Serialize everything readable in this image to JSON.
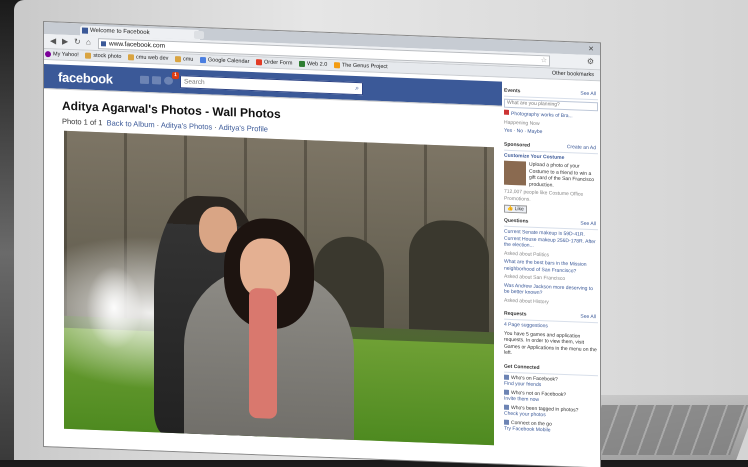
{
  "browser": {
    "tab_title": "Welcome to Facebook",
    "url": "www.facebook.com",
    "bookmarks": [
      "My Yahoo!",
      "stock photo",
      "cmu web dev",
      "cmu",
      "Google Calendar",
      "Order Form",
      "Web 2.0",
      "The Genus Project"
    ],
    "other_bookmarks": "Other bookmarks"
  },
  "facebook": {
    "logo": "facebook",
    "notification_count": "1",
    "search_placeholder": "Search"
  },
  "page": {
    "title": "Aditya Agarwal's Photos - Wall Photos",
    "photo_counter": "Photo 1 of 1",
    "back_to_album": "Back to Album",
    "dot1": "·",
    "photos_link": "Aditya's Photos",
    "dot2": "·",
    "profile_link": "Aditya's Profile"
  },
  "sidebar": {
    "events": {
      "header": "Events",
      "see_all": "See All",
      "input_placeholder": "What are you planning?",
      "item_title": "Photography works of Bra...",
      "item_sub": "Happening Now",
      "rsvp": "Yes · No · Maybe"
    },
    "sponsored": {
      "header": "Sponsored",
      "create_ad": "Create an Ad",
      "ad_title": "Customize Your Costume",
      "ad_text": "Upload a photo of your Costume to a friend to win a gift card of the San Francisco production.",
      "ad_likes": "712,007 people like Costume Office Promotions.",
      "like_button": "Like"
    },
    "questions": {
      "header": "Questions",
      "see_all": "See All",
      "q1": "Current Senate makeup is 59D-41R. Current House makeup 256D-178R. After the election...",
      "q1_meta": "Asked about Politics",
      "q2": "What are the best bars in the Mission neighborhood of San Francisco?",
      "q2_meta": "Asked about San Francisco",
      "q3": "Was Andrew Jackson more deserving to be better known?",
      "q3_meta": "Asked about History"
    },
    "requests": {
      "header": "Requests",
      "see_all": "See All",
      "item": "4 Page suggestions",
      "text": "You have 5 games and application requests. In order to view them, visit Games or Applications in the menu on the left."
    },
    "get_connected": {
      "header": "Get Connected",
      "i1": "Who's on Facebook?",
      "i1_link": "Find your friends",
      "i2": "Who's not on Facebook?",
      "i2_link": "Invite them now",
      "i3": "Who's been tagged in photos?",
      "i3_link": "Check your photos",
      "i4": "Connect on the go",
      "i4_link": "Try Facebook Mobile"
    }
  }
}
